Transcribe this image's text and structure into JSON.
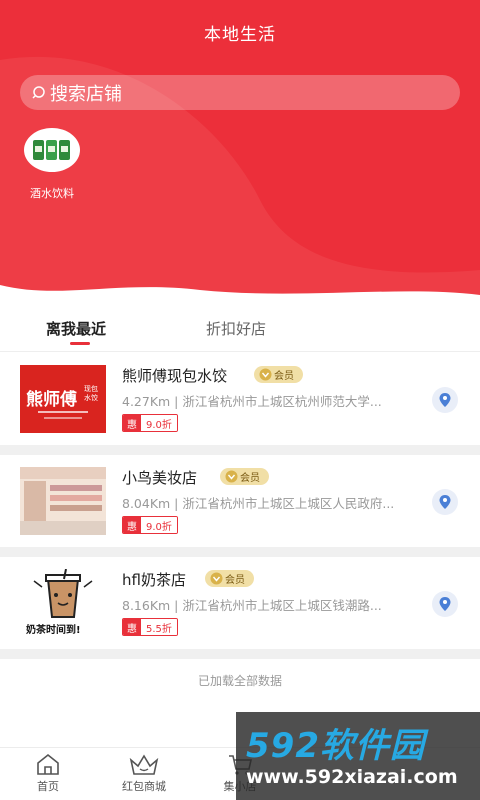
{
  "header": {
    "title": "本地生活"
  },
  "search": {
    "placeholder": "搜索店铺"
  },
  "categories": [
    {
      "label": "酒水饮料",
      "icon": "beverage-cans-icon"
    }
  ],
  "tabs": [
    {
      "label": "离我最近",
      "active": true
    },
    {
      "label": "折扣好店",
      "active": false
    }
  ],
  "stores": [
    {
      "name": "熊师傅现包水饺",
      "vip": "会员",
      "distance_address": "4.27Km | 浙江省杭州市上城区杭州师范大学...",
      "discount_tag": "惠",
      "discount": "9.0折",
      "thumb_text": "熊师傅",
      "thumb_sub": "现包水饺"
    },
    {
      "name": "小鸟美妆店",
      "vip": "会员",
      "distance_address": "8.04Km | 浙江省杭州市上城区上城区人民政府...",
      "discount_tag": "惠",
      "discount": "9.0折"
    },
    {
      "name": "hfl奶茶店",
      "vip": "会员",
      "distance_address": "8.16Km | 浙江省杭州市上城区上城区钱潮路...",
      "discount_tag": "惠",
      "discount": "5.5折",
      "thumb_text": "奶茶时间到!"
    }
  ],
  "status": {
    "loaded_all": "已加载全部数据"
  },
  "tabbar": [
    {
      "label": "首页",
      "icon": "home-icon"
    },
    {
      "label": "红包商城",
      "icon": "crown-icon"
    },
    {
      "label": "集小店",
      "icon": "cart-icon"
    }
  ],
  "watermark": {
    "logo": "592软件园",
    "url": "www.592xiazai.com"
  },
  "colors": {
    "brand_red": "#ec2f3a",
    "vip_gold": "#f1dfa6",
    "loc_blue": "#4a7fd6"
  }
}
